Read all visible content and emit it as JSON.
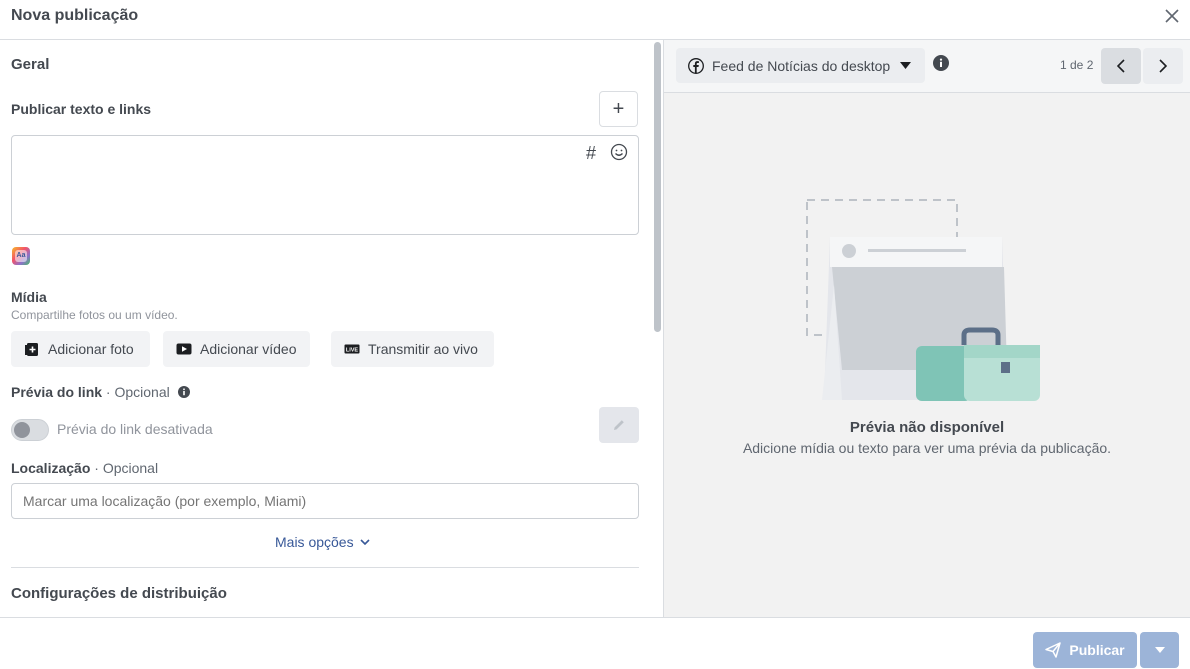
{
  "header": {
    "title": "Nova publicação"
  },
  "general": {
    "section_title": "Geral",
    "post_text_label": "Publicar texto e links",
    "plus_symbol": "+",
    "hashtag_symbol": "#"
  },
  "media": {
    "label": "Mídia",
    "subtitle": "Compartilhe fotos ou um vídeo.",
    "buttons": [
      "Adicionar foto",
      "Adicionar vídeo",
      "Transmitir ao vivo"
    ]
  },
  "link_preview": {
    "label": "Prévia do link",
    "optional": " · Opcional",
    "toggle_label": "Prévia do link desativada"
  },
  "location": {
    "label": "Localização",
    "optional": " · Opcional",
    "placeholder": "Marcar uma localização (por exemplo, Miami)"
  },
  "more_options": "Mais opções",
  "distribution": {
    "section_title": "Configurações de distribuição"
  },
  "preview": {
    "placement": "Feed de Notícias do desktop",
    "pager": "1 de 2",
    "unavailable_title": "Prévia não disponível",
    "unavailable_sub": "Adicione mídia ou texto para ver uma prévia da publicação."
  },
  "footer": {
    "publish_label": "Publicar"
  },
  "colors": {
    "accent": "#385898",
    "publish_disabled": "#9cb4d8"
  }
}
